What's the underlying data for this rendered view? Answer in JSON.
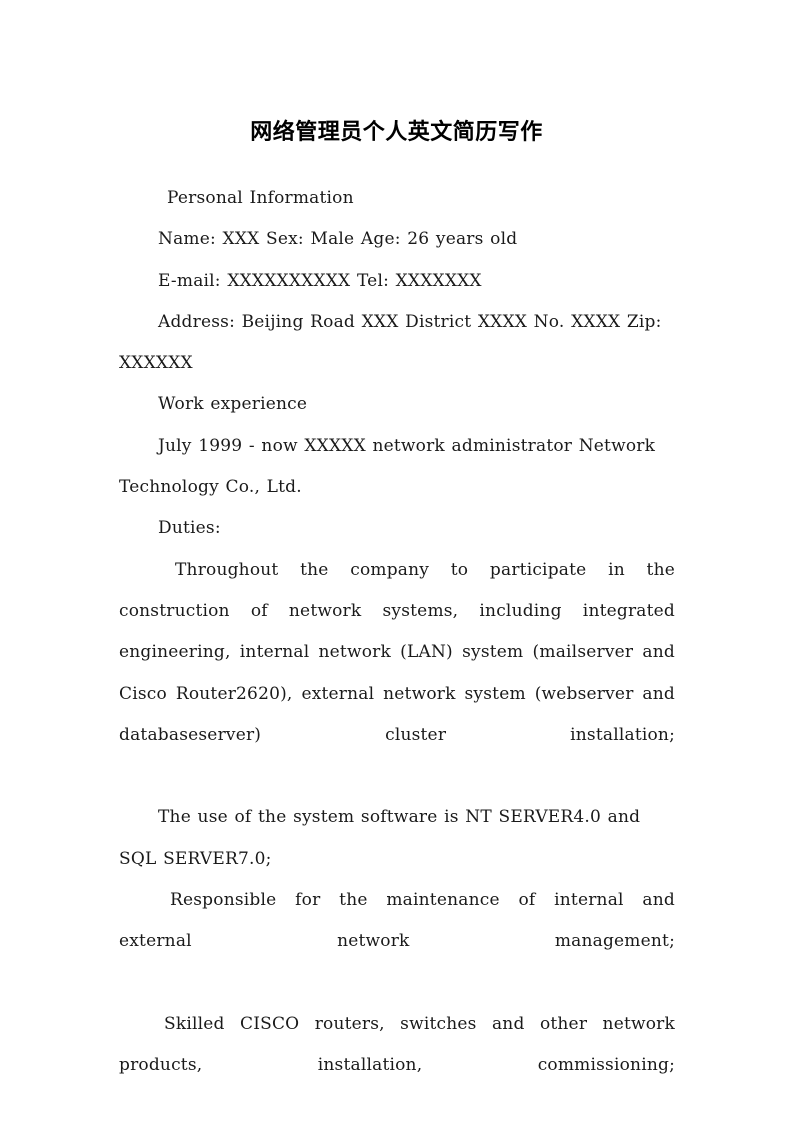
{
  "document": {
    "title": "网络管理员个人英文简历写作",
    "background_color": "#ffffff",
    "text_color": "#1a1a1a",
    "sections": {
      "personal_information_heading": "Personal Information",
      "name_line": "Name: XXX Sex: Male Age: 26 years old",
      "email_line": "E-mail: XXXXXXXXXX Tel: XXXXXXX",
      "address_line": "Address: Beijing Road XXX District XXXX No. XXXX Zip: XXXXXX",
      "work_experience_heading": "Work experience",
      "employment_line": "July 1999 - now XXXXX network administrator Network Technology Co., Ltd.",
      "duties_heading": "Duties:",
      "duty_1": "Throughout the company to participate in the construction of network systems, including integrated engineering, internal network (LAN) system (mailserver and Cisco Router2620), external network system (webserver and databaseserver) cluster installation;",
      "duty_2": "The use of the system software is NT SERVER4.0 and SQL SERVER7.0;",
      "duty_3": "Responsible for the maintenance of internal and external network management;",
      "duty_4": "Skilled CISCO routers, switches and other network products, installation, commissioning;"
    }
  }
}
